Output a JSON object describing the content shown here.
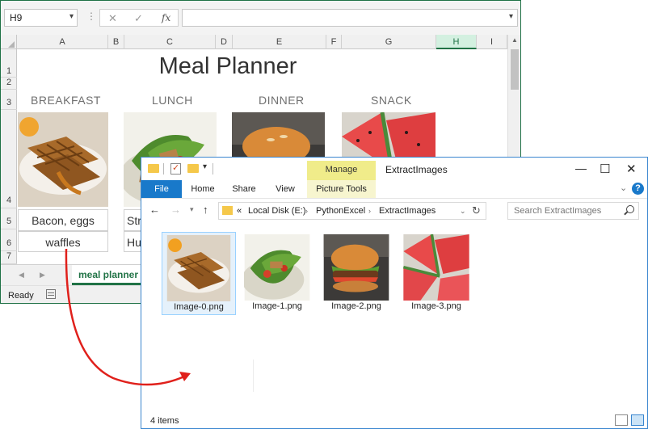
{
  "excel": {
    "name_box": "H9",
    "formula_value": "",
    "columns": [
      "A",
      "B",
      "C",
      "D",
      "E",
      "F",
      "G",
      "H",
      "I"
    ],
    "selected_column": "H",
    "rows": [
      "1",
      "2",
      "3",
      "4",
      "5",
      "6",
      "7"
    ],
    "title": "Meal Planner",
    "meals": [
      {
        "label": "BREAKFAST",
        "row5": "Bacon, eggs",
        "row6": "waffles"
      },
      {
        "label": "LUNCH",
        "row5": "Str",
        "row6": "Hu"
      },
      {
        "label": "DINNER",
        "row5": "",
        "row6": ""
      },
      {
        "label": "SNACK",
        "row5": "",
        "row6": ""
      }
    ],
    "sheet_tab": "meal planner",
    "status": "Ready"
  },
  "explorer": {
    "title": "ExtractImages",
    "manage_tab": "Manage",
    "ribbon_tabs": [
      "File",
      "Home",
      "Share",
      "View",
      "Picture Tools"
    ],
    "address": {
      "prefix": "«",
      "crumbs": [
        "Local Disk (E:)",
        "PythonExcel",
        "ExtractImages"
      ]
    },
    "search_placeholder": "Search ExtractImages",
    "files": [
      {
        "name": "Image-0.png",
        "subject": "waffle"
      },
      {
        "name": "Image-1.png",
        "subject": "salad"
      },
      {
        "name": "Image-2.png",
        "subject": "burger"
      },
      {
        "name": "Image-3.png",
        "subject": "watermelon"
      }
    ],
    "selected_file_index": 0,
    "item_count": "4 items"
  },
  "colors": {
    "excel_green": "#217346",
    "explorer_blue": "#1979ca",
    "manage_yellow": "#f0ec8a",
    "arrow_red": "#e0201b"
  }
}
